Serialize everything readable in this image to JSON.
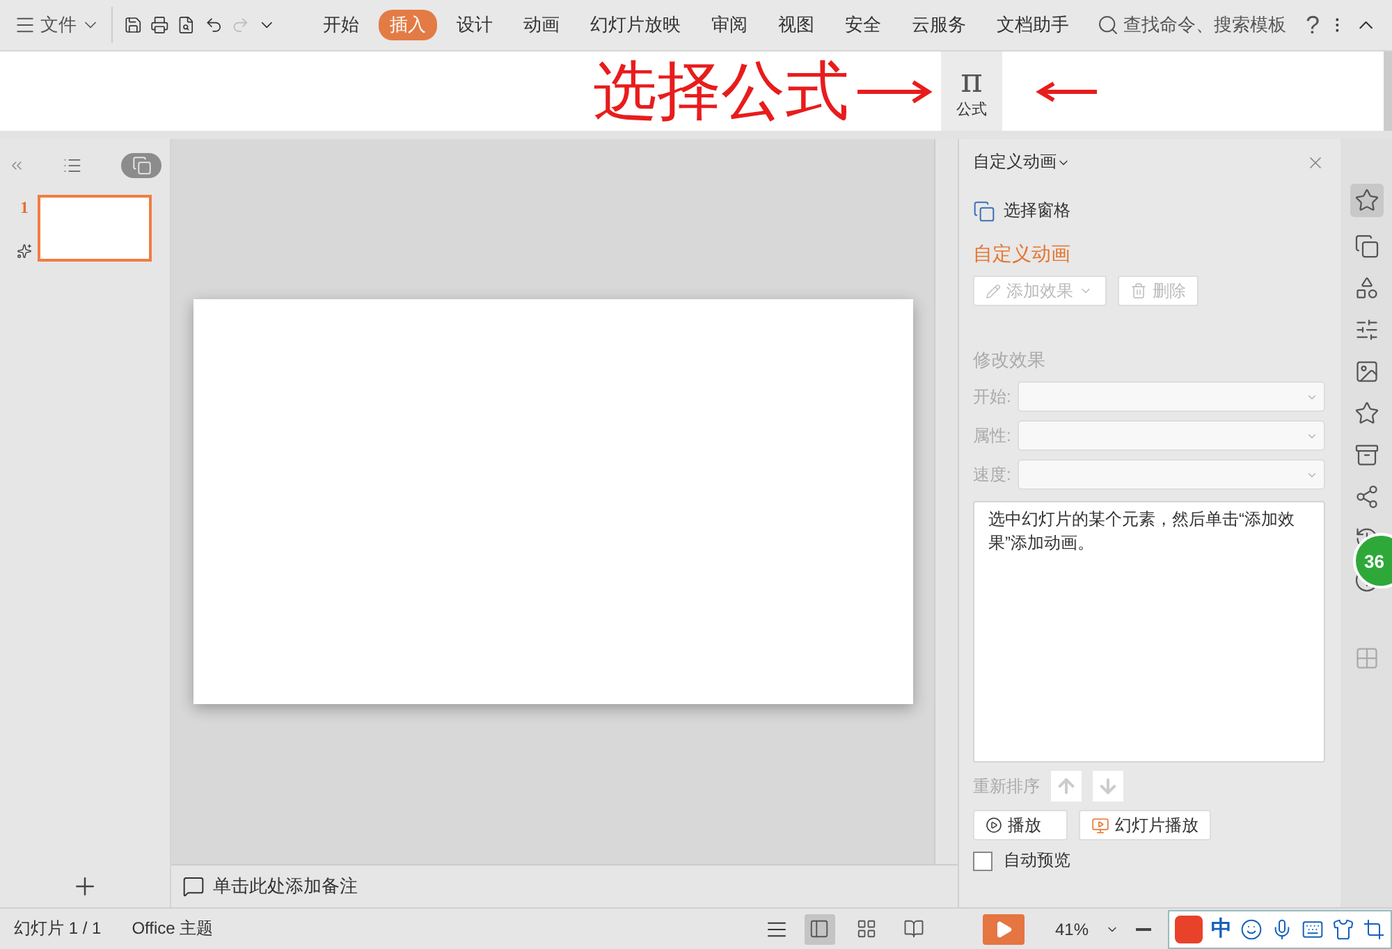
{
  "menu": {
    "label": "文件"
  },
  "tabs": [
    {
      "label": "开始",
      "selected": false
    },
    {
      "label": "插入",
      "selected": true
    },
    {
      "label": "设计",
      "selected": false
    },
    {
      "label": "动画",
      "selected": false
    },
    {
      "label": "幻灯片放映",
      "selected": false
    },
    {
      "label": "审阅",
      "selected": false
    },
    {
      "label": "视图",
      "selected": false
    },
    {
      "label": "安全",
      "selected": false
    },
    {
      "label": "云服务",
      "selected": false
    },
    {
      "label": "文档助手",
      "selected": false
    }
  ],
  "search": {
    "label": "查找命令、搜索模板"
  },
  "help": {
    "label": "?"
  },
  "annotation": {
    "text": "选择公式"
  },
  "formula_button": {
    "symbol": "π",
    "label": "公式"
  },
  "slides_panel": {
    "views": [
      {
        "kind": "outline",
        "selected": false
      },
      {
        "kind": "slides",
        "selected": true
      }
    ],
    "slides": [
      {
        "number": "1",
        "selected": true
      }
    ]
  },
  "notes": {
    "placeholder": "单击此处添加备注"
  },
  "animation_pane": {
    "title": "自定义动画",
    "selection_pane": "选择窗格",
    "section": "自定义动画",
    "add_effect": {
      "label": "添加效果",
      "disabled": true
    },
    "delete": {
      "label": "删除",
      "disabled": true
    },
    "modify_heading": "修改效果",
    "fields": [
      {
        "label": "开始:"
      },
      {
        "label": "属性:"
      },
      {
        "label": "速度:"
      }
    ],
    "hint": "选中幻灯片的某个元素，然后单击“添加效果”添加动画。",
    "reorder": "重新排序",
    "play": "播放",
    "slideshow": "幻灯片播放",
    "autopreview": {
      "label": "自动预览",
      "checked": false
    }
  },
  "badge": {
    "label": "36"
  },
  "status_bar": {
    "slide": "幻灯片 1 / 1",
    "theme": "Office 主题",
    "views": [
      {
        "kind": "normal",
        "selected": true
      },
      {
        "kind": "sorter",
        "selected": false
      },
      {
        "kind": "reading",
        "selected": false
      }
    ],
    "zoom": "41%",
    "ime": "中"
  }
}
